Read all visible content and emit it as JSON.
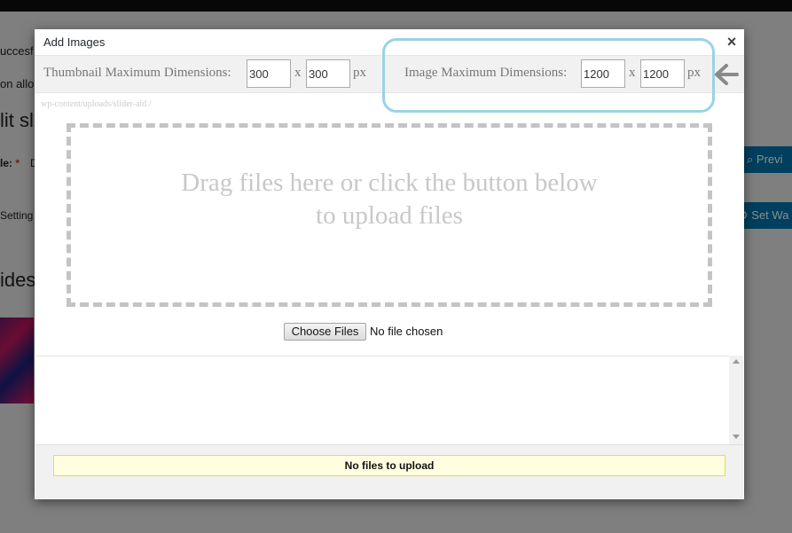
{
  "background": {
    "notice_text": "uccesf",
    "notice_text_2": "on allo",
    "heading_fragment": "lit sl",
    "title_label": "le:",
    "required_mark": "*",
    "title_value_fragment": "D",
    "settings_tab_fragment": "Setting",
    "slides_heading_fragment": "ides",
    "preview_button": "Previ",
    "set_button": "Set Wa"
  },
  "modal": {
    "title": "Add Images",
    "close_icon": "×",
    "thumbnail_label": "Thumbnail Maximum Dimensions:",
    "thumbnail_width": "300",
    "thumbnail_height": "300",
    "image_label": "Image Maximum Dimensions:",
    "image_width": "1200",
    "image_height": "1200",
    "times": "x",
    "unit": "px",
    "path_text": "wp-content/uploads/slider-aid /",
    "drop_text_line1": "Drag files here or click the button below",
    "drop_text_line2": "to upload files",
    "choose_button": "Choose Files",
    "no_file_text": "No file chosen",
    "status_text": "No files to upload"
  },
  "colors": {
    "highlight": "#9ad3e3",
    "status_bg": "#ffffe0",
    "accent_button": "#0073aa"
  }
}
